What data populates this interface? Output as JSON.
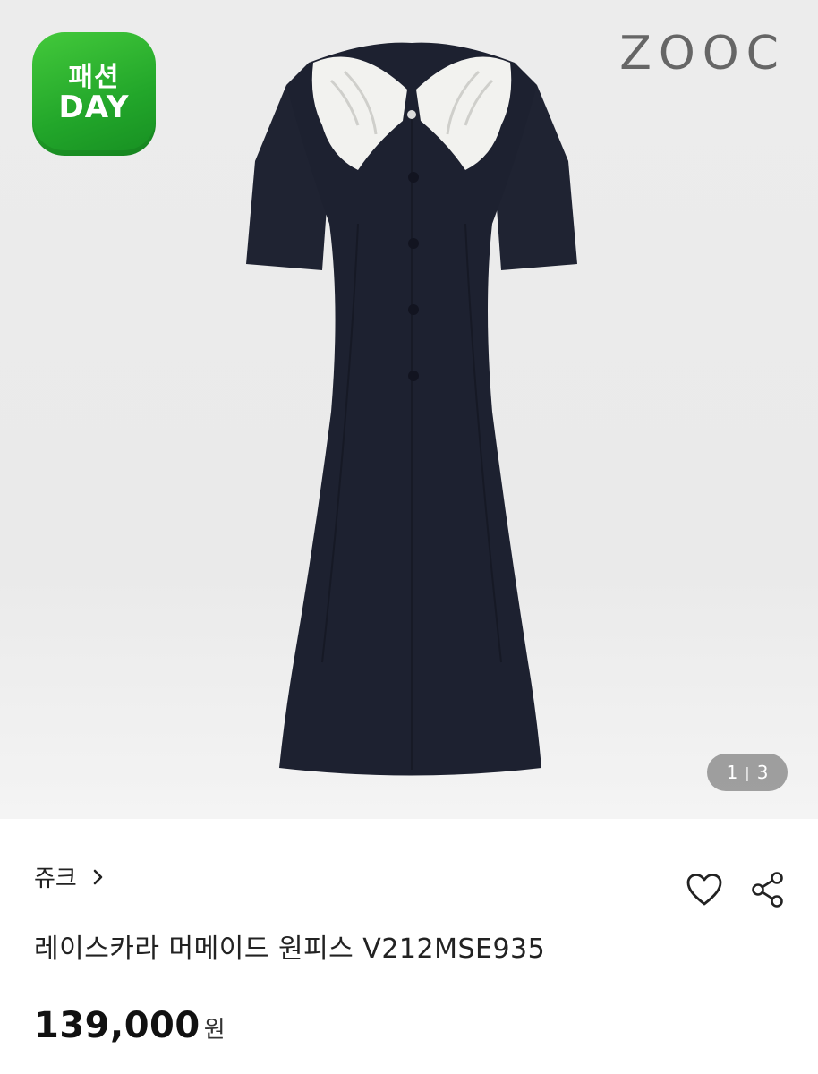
{
  "badge": {
    "line1": "패션",
    "line2": "DAY"
  },
  "brand_logo": "ZOOC",
  "image_counter": {
    "current": "1",
    "separator": "|",
    "total": "3"
  },
  "product": {
    "brand": "쥬크",
    "title": "레이스카라 머메이드 원피스 V212MSE935",
    "price": "139,000",
    "currency": "원"
  },
  "icons": [
    "chevron-right-icon",
    "heart-icon",
    "share-icon"
  ],
  "colors": {
    "badge_green": "#22a62a",
    "dress": "#1d2130",
    "collar": "#f2f2ef"
  }
}
